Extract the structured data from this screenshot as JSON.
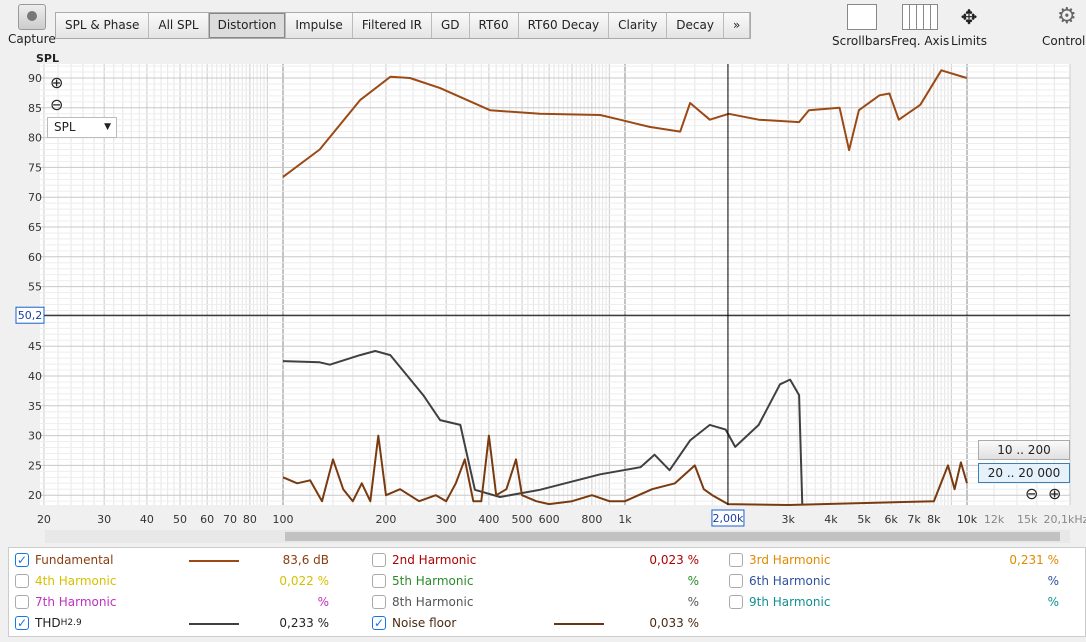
{
  "toolbar": {
    "capture": "Capture",
    "tabs": [
      "SPL & Phase",
      "All SPL",
      "Distortion",
      "Impulse",
      "Filtered IR",
      "GD",
      "RT60",
      "RT60 Decay",
      "Clarity",
      "Decay",
      "»"
    ],
    "active": "Distortion",
    "right": [
      {
        "label": "Scrollbars",
        "icon": "scrollbars-icon"
      },
      {
        "label": "Freq. Axis",
        "icon": "freq-axis-icon"
      },
      {
        "label": "Limits",
        "icon": "limits-icon"
      },
      {
        "label": "Controls",
        "icon": "gear-icon"
      }
    ]
  },
  "plot": {
    "ylabel": "SPL",
    "selector": "SPL",
    "cursor_y": "50,2",
    "cursor_x": "2,00k",
    "cursor_freq": 2000,
    "cursor_db": 50.2,
    "yticks": [
      90,
      85,
      80,
      75,
      70,
      65,
      60,
      55,
      45,
      40,
      35,
      30,
      25,
      20
    ],
    "xticks": [
      {
        "f": 20,
        "l": "20"
      },
      {
        "f": 30,
        "l": "30"
      },
      {
        "f": 40,
        "l": "40"
      },
      {
        "f": 50,
        "l": "50"
      },
      {
        "f": 60,
        "l": "60"
      },
      {
        "f": 70,
        "l": "70"
      },
      {
        "f": 80,
        "l": "80"
      },
      {
        "f": 100,
        "l": "100"
      },
      {
        "f": 200,
        "l": "200"
      },
      {
        "f": 300,
        "l": "300"
      },
      {
        "f": 400,
        "l": "400"
      },
      {
        "f": 500,
        "l": "500"
      },
      {
        "f": 600,
        "l": "600"
      },
      {
        "f": 800,
        "l": "800"
      },
      {
        "f": 1000,
        "l": "1k"
      },
      {
        "f": 3000,
        "l": "3k"
      },
      {
        "f": 4000,
        "l": "4k"
      },
      {
        "f": 5000,
        "l": "5k"
      },
      {
        "f": 6000,
        "l": "6k"
      },
      {
        "f": 7000,
        "l": "7k"
      },
      {
        "f": 8000,
        "l": "8k"
      },
      {
        "f": 10000,
        "l": "10k"
      },
      {
        "f": 12000,
        "l": "12k"
      },
      {
        "f": 15000,
        "l": "15k"
      },
      {
        "f": 20100,
        "l": "20,1kHz"
      }
    ],
    "range_buttons": [
      "10 .. 200",
      "20 .. 20 000"
    ]
  },
  "chart_data": {
    "type": "line",
    "xscale": "log",
    "xlim": [
      20,
      20100
    ],
    "ylim": [
      18,
      92
    ],
    "series": [
      {
        "name": "Fundamental",
        "color": "#9b4a16",
        "points": [
          [
            100,
            73.4
          ],
          [
            128,
            78
          ],
          [
            168,
            86.3
          ],
          [
            206,
            90.2
          ],
          [
            235,
            90
          ],
          [
            288,
            88.3
          ],
          [
            403,
            84.6
          ],
          [
            564,
            84
          ],
          [
            846,
            83.8
          ],
          [
            967,
            83
          ],
          [
            1180,
            81.8
          ],
          [
            1450,
            81
          ],
          [
            1550,
            85.8
          ],
          [
            1770,
            83
          ],
          [
            2010,
            84
          ],
          [
            2460,
            83
          ],
          [
            3230,
            82.6
          ],
          [
            3450,
            84.6
          ],
          [
            4240,
            85
          ],
          [
            4520,
            77.9
          ],
          [
            4830,
            84.6
          ],
          [
            5550,
            87.1
          ],
          [
            5930,
            87.4
          ],
          [
            6320,
            83
          ],
          [
            7300,
            85.5
          ],
          [
            8410,
            91.3
          ],
          [
            9980,
            90
          ]
        ]
      },
      {
        "name": "THD",
        "color": "#404040",
        "points": [
          [
            100,
            42.5
          ],
          [
            128,
            42.3
          ],
          [
            137,
            41.9
          ],
          [
            168,
            43.5
          ],
          [
            186,
            44.2
          ],
          [
            206,
            43.5
          ],
          [
            257,
            36.8
          ],
          [
            288,
            32.6
          ],
          [
            330,
            31.8
          ],
          [
            364,
            20.9
          ],
          [
            431,
            19.7
          ],
          [
            564,
            20.9
          ],
          [
            846,
            23.5
          ],
          [
            1110,
            24.7
          ],
          [
            1220,
            26.8
          ],
          [
            1350,
            24.2
          ],
          [
            1550,
            29.2
          ],
          [
            1770,
            31.8
          ],
          [
            1970,
            31
          ],
          [
            2100,
            28.1
          ],
          [
            2460,
            31.8
          ],
          [
            2840,
            38.6
          ],
          [
            3040,
            39.4
          ],
          [
            3230,
            36.8
          ],
          [
            3300,
            18
          ]
        ]
      },
      {
        "name": "Noise floor",
        "color": "#7a3a10",
        "points": [
          [
            100,
            23
          ],
          [
            110,
            22
          ],
          [
            120,
            22.5
          ],
          [
            130,
            19
          ],
          [
            140,
            26
          ],
          [
            150,
            21
          ],
          [
            160,
            19
          ],
          [
            170,
            22
          ],
          [
            180,
            19
          ],
          [
            190,
            30
          ],
          [
            200,
            20
          ],
          [
            220,
            21
          ],
          [
            250,
            19
          ],
          [
            280,
            20
          ],
          [
            300,
            19
          ],
          [
            320,
            22
          ],
          [
            340,
            26
          ],
          [
            360,
            19
          ],
          [
            380,
            19
          ],
          [
            400,
            30
          ],
          [
            420,
            20
          ],
          [
            450,
            21
          ],
          [
            480,
            26
          ],
          [
            500,
            20
          ],
          [
            550,
            19
          ],
          [
            600,
            18.5
          ],
          [
            700,
            19
          ],
          [
            800,
            20
          ],
          [
            900,
            19
          ],
          [
            1000,
            19
          ],
          [
            1200,
            21
          ],
          [
            1400,
            22
          ],
          [
            1600,
            25
          ],
          [
            1700,
            21
          ],
          [
            1800,
            20
          ],
          [
            2000,
            18.5
          ],
          [
            3000,
            18
          ],
          [
            8000,
            19
          ],
          [
            8800,
            25
          ],
          [
            9200,
            21
          ],
          [
            9600,
            25.5
          ],
          [
            10000,
            22
          ]
        ]
      }
    ]
  },
  "legend": [
    {
      "label": "Fundamental",
      "checked": true,
      "value": "83,6 dB",
      "color": "#8a3d10",
      "line": "#9b4a16"
    },
    {
      "label": "2nd Harmonic",
      "checked": false,
      "value": "0,023 %",
      "color": "#b00000"
    },
    {
      "label": "3rd Harmonic",
      "checked": false,
      "value": "0,231 %",
      "color": "#e08a00"
    },
    {
      "label": "4th Harmonic",
      "checked": false,
      "value": "0,022 %",
      "color": "#d8c000"
    },
    {
      "label": "5th Harmonic",
      "checked": false,
      "value": "%",
      "color": "#2a8a2a"
    },
    {
      "label": "6th Harmonic",
      "checked": false,
      "value": "%",
      "color": "#3050a0"
    },
    {
      "label": "7th Harmonic",
      "checked": false,
      "value": "%",
      "color": "#c030c0"
    },
    {
      "label": "8th Harmonic",
      "checked": false,
      "value": "%",
      "color": "#555555"
    },
    {
      "label": "9th Harmonic",
      "checked": false,
      "value": "%",
      "color": "#109090"
    },
    {
      "label": "THD",
      "sub": "H2.9",
      "checked": true,
      "value": "0,233 %",
      "color": "#222222",
      "line": "#404040"
    },
    {
      "label": "Noise floor",
      "checked": true,
      "value": "0,033 %",
      "color": "#4a2a10",
      "line": "#6a3510"
    }
  ]
}
